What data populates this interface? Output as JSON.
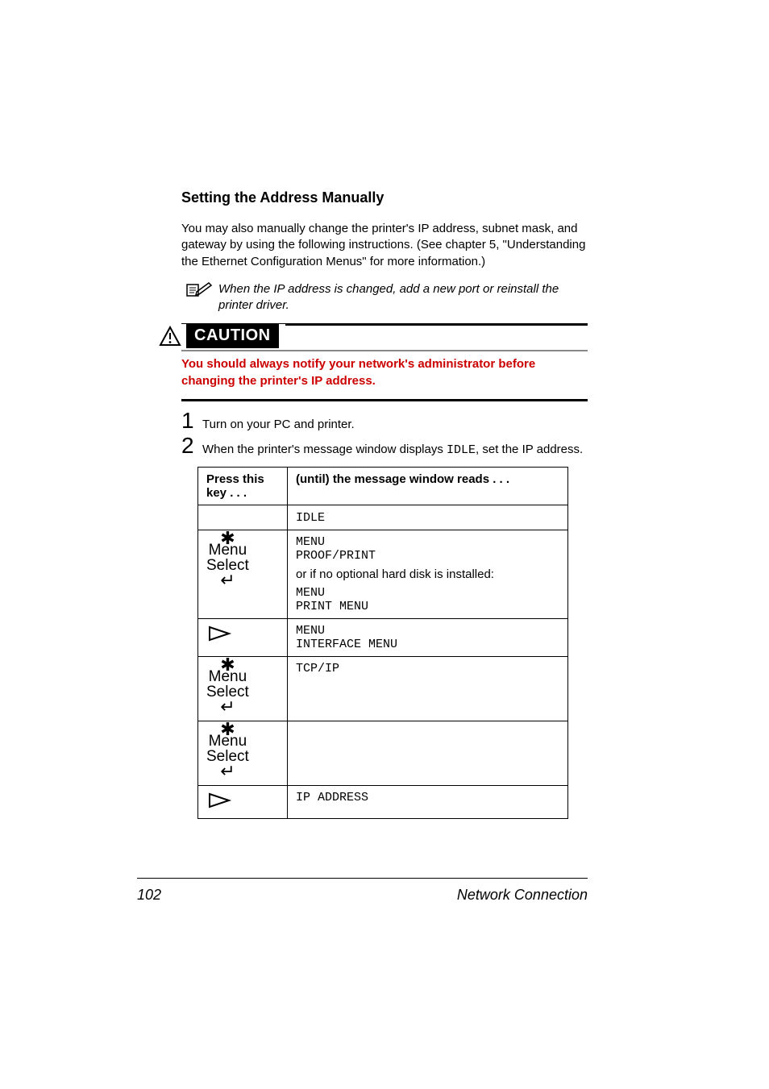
{
  "heading": "Setting the Address Manually",
  "intro": "You may also manually change the printer's IP address, subnet mask, and gateway by using the following instructions. (See chapter 5, \"Understanding the Ethernet Configuration Menus\" for more information.)",
  "note": "When the IP address is changed, add a new port or reinstall the printer driver.",
  "caution_label": "CAUTION",
  "caution_text": "You should always notify your network's administrator before changing the printer's IP address.",
  "steps": {
    "one": {
      "num": "1",
      "text": "Turn on your PC and printer."
    },
    "two": {
      "num": "2",
      "pre": "When the printer's message window displays ",
      "code": "IDLE",
      "post": ", set the IP address."
    }
  },
  "table": {
    "head": {
      "keycol": "Press this key . . .",
      "msgcol": "(until) the message window reads  . . ."
    },
    "rows": {
      "r0": {
        "msg": "IDLE"
      },
      "r1": {
        "key_label_top": "Menu",
        "key_label_bottom": "Select",
        "line1": "MENU",
        "line2": "PROOF/PRINT",
        "mid": "or if no optional hard disk is installed:",
        "line3": "MENU",
        "line4": "PRINT MENU"
      },
      "r2": {
        "line1": "MENU",
        "line2": "INTERFACE MENU"
      },
      "r3": {
        "key_label_top": "Menu",
        "key_label_bottom": "Select",
        "line1": "TCP/IP"
      },
      "r4": {
        "key_label_top": "Menu",
        "key_label_bottom": "Select"
      },
      "r5": {
        "line1": "IP ADDRESS"
      }
    }
  },
  "footer": {
    "page": "102",
    "title": "Network Connection"
  }
}
